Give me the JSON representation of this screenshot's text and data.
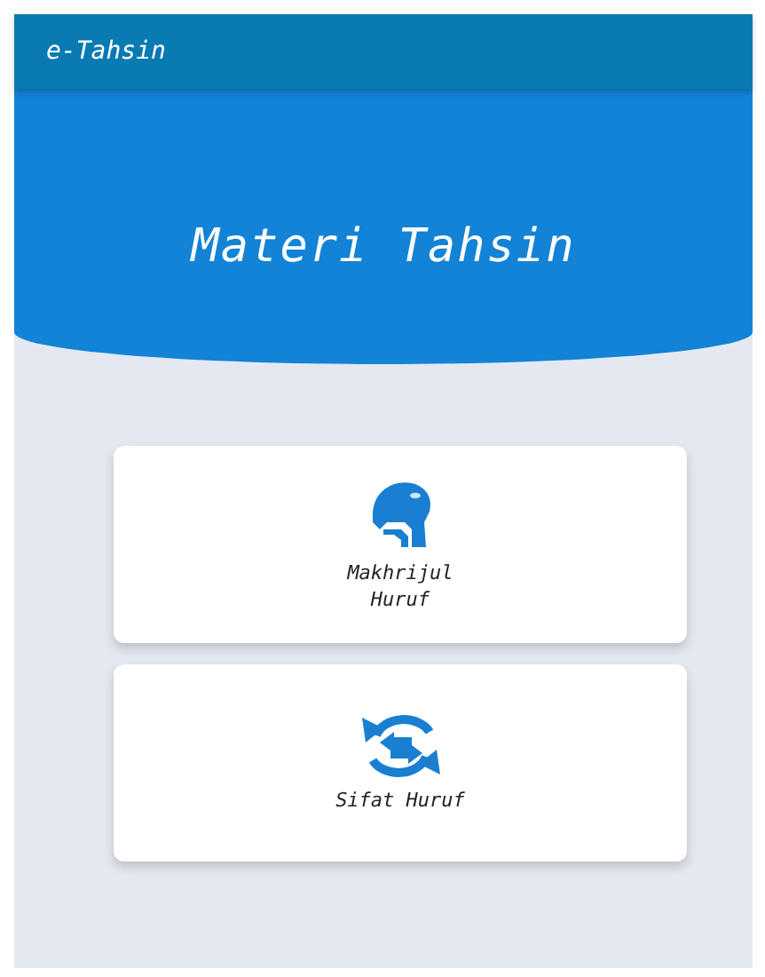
{
  "app_bar": {
    "title": "e-Tahsin"
  },
  "header": {
    "title": "Materi Tahsin"
  },
  "menu": [
    {
      "kind": "head",
      "label": "Makhrijul\nHuruf"
    },
    {
      "kind": "exchange",
      "label": "Sifat Huruf"
    }
  ]
}
